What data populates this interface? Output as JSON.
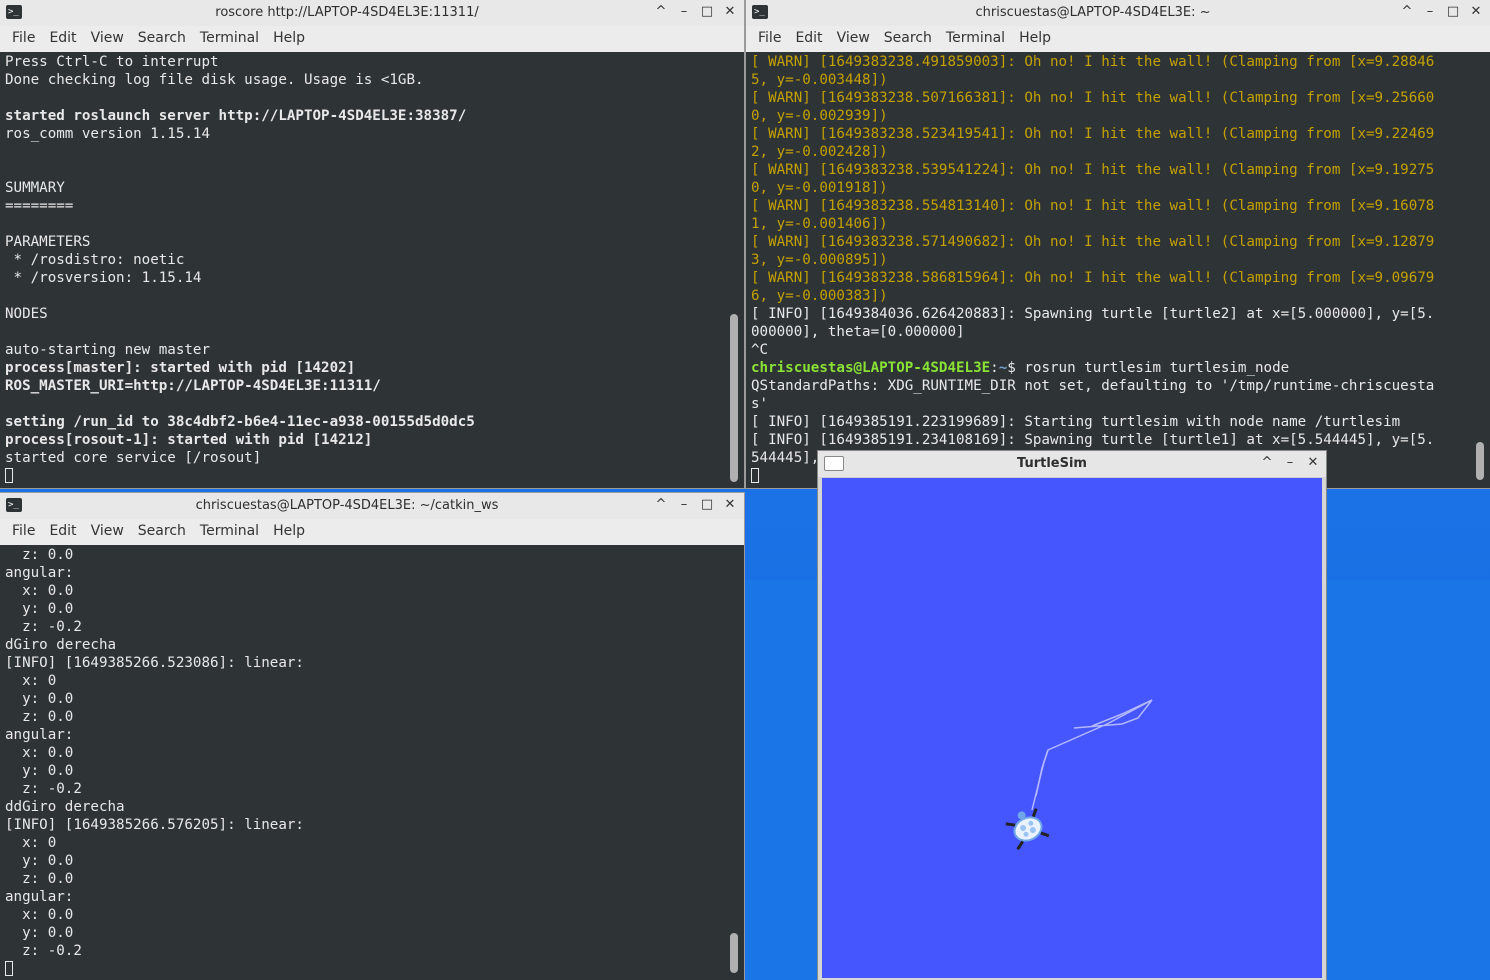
{
  "colors": {
    "terminal_bg": "#2e3436",
    "warn_text": "#c4a000",
    "prompt_user": "#8ae234",
    "prompt_path": "#729fcf",
    "turtlesim_bg": "#4556ff",
    "desktop": "#1a73e8"
  },
  "menus": [
    "File",
    "Edit",
    "View",
    "Search",
    "Terminal",
    "Help"
  ],
  "window_buttons": {
    "maximize": "^",
    "minimize": "–",
    "restore": "□",
    "close": "✕"
  },
  "roscore": {
    "title": "roscore http://LAPTOP-4SD4EL3E:11311/",
    "lines": [
      {
        "t": "Press Ctrl-C to interrupt",
        "s": ""
      },
      {
        "t": "Done checking log file disk usage. Usage is <1GB.",
        "s": ""
      },
      {
        "t": "",
        "s": ""
      },
      {
        "t": "started roslaunch server http://LAPTOP-4SD4EL3E:38387/",
        "s": "bold"
      },
      {
        "t": "ros_comm version 1.15.14",
        "s": ""
      },
      {
        "t": "",
        "s": ""
      },
      {
        "t": "",
        "s": ""
      },
      {
        "t": "SUMMARY",
        "s": ""
      },
      {
        "t": "========",
        "s": ""
      },
      {
        "t": "",
        "s": ""
      },
      {
        "t": "PARAMETERS",
        "s": ""
      },
      {
        "t": " * /rosdistro: noetic",
        "s": ""
      },
      {
        "t": " * /rosversion: 1.15.14",
        "s": ""
      },
      {
        "t": "",
        "s": ""
      },
      {
        "t": "NODES",
        "s": ""
      },
      {
        "t": "",
        "s": ""
      },
      {
        "t": "auto-starting new master",
        "s": ""
      },
      {
        "t": "process[master]: started with pid [14202]",
        "s": "bold"
      },
      {
        "t": "ROS_MASTER_URI=http://LAPTOP-4SD4EL3E:11311/",
        "s": "bold"
      },
      {
        "t": "",
        "s": ""
      },
      {
        "t": "setting /run_id to 38c4dbf2-b6e4-11ec-a938-00155d5d0dc5",
        "s": "bold"
      },
      {
        "t": "process[rosout-1]: started with pid [14212]",
        "s": "bold"
      },
      {
        "t": "started core service [/rosout]",
        "s": ""
      }
    ]
  },
  "turtlenode": {
    "title": "chriscuestas@LAPTOP-4SD4EL3E: ~",
    "lines_before": [
      {
        "t": "[ WARN] [1649383238.491859003]: Oh no! I hit the wall! (Clamping from [x=9.28846",
        "s": "warn"
      },
      {
        "t": "5, y=-0.003448])",
        "s": "warn"
      },
      {
        "t": "[ WARN] [1649383238.507166381]: Oh no! I hit the wall! (Clamping from [x=9.25660",
        "s": "warn"
      },
      {
        "t": "0, y=-0.002939])",
        "s": "warn"
      },
      {
        "t": "[ WARN] [1649383238.523419541]: Oh no! I hit the wall! (Clamping from [x=9.22469",
        "s": "warn"
      },
      {
        "t": "2, y=-0.002428])",
        "s": "warn"
      },
      {
        "t": "[ WARN] [1649383238.539541224]: Oh no! I hit the wall! (Clamping from [x=9.19275",
        "s": "warn"
      },
      {
        "t": "0, y=-0.001918])",
        "s": "warn"
      },
      {
        "t": "[ WARN] [1649383238.554813140]: Oh no! I hit the wall! (Clamping from [x=9.16078",
        "s": "warn"
      },
      {
        "t": "1, y=-0.001406])",
        "s": "warn"
      },
      {
        "t": "[ WARN] [1649383238.571490682]: Oh no! I hit the wall! (Clamping from [x=9.12879",
        "s": "warn"
      },
      {
        "t": "3, y=-0.000895])",
        "s": "warn"
      },
      {
        "t": "[ WARN] [1649383238.586815964]: Oh no! I hit the wall! (Clamping from [x=9.09679",
        "s": "warn"
      },
      {
        "t": "6, y=-0.000383])",
        "s": "warn"
      },
      {
        "t": "[ INFO] [1649384036.626420883]: Spawning turtle [turtle2] at x=[5.000000], y=[5.",
        "s": ""
      },
      {
        "t": "000000], theta=[0.000000]",
        "s": ""
      },
      {
        "t": "^C",
        "s": ""
      }
    ],
    "prompt": {
      "user": "chriscuestas@LAPTOP-4SD4EL3E",
      "sep": ":",
      "path": "~",
      "end": "$ ",
      "command": "rosrun turtlesim turtlesim_node"
    },
    "lines_after": [
      {
        "t": "QStandardPaths: XDG_RUNTIME_DIR not set, defaulting to '/tmp/runtime-chriscuesta",
        "s": ""
      },
      {
        "t": "s'",
        "s": ""
      },
      {
        "t": "[ INFO] [1649385191.223199689]: Starting turtlesim with node name /turtlesim",
        "s": ""
      },
      {
        "t": "[ INFO] [1649385191.234108169]: Spawning turtle [turtle1] at x=[5.544445], y=[5.",
        "s": ""
      },
      {
        "t": "544445],",
        "s": ""
      }
    ]
  },
  "catkin": {
    "title": "chriscuestas@LAPTOP-4SD4EL3E: ~/catkin_ws",
    "lines": [
      {
        "t": "  z: 0.0",
        "s": ""
      },
      {
        "t": "angular:",
        "s": ""
      },
      {
        "t": "  x: 0.0",
        "s": ""
      },
      {
        "t": "  y: 0.0",
        "s": ""
      },
      {
        "t": "  z: -0.2",
        "s": ""
      },
      {
        "t": "dGiro derecha",
        "s": ""
      },
      {
        "t": "[INFO] [1649385266.523086]: linear:",
        "s": ""
      },
      {
        "t": "  x: 0",
        "s": ""
      },
      {
        "t": "  y: 0.0",
        "s": ""
      },
      {
        "t": "  z: 0.0",
        "s": ""
      },
      {
        "t": "angular:",
        "s": ""
      },
      {
        "t": "  x: 0.0",
        "s": ""
      },
      {
        "t": "  y: 0.0",
        "s": ""
      },
      {
        "t": "  z: -0.2",
        "s": ""
      },
      {
        "t": "ddGiro derecha",
        "s": ""
      },
      {
        "t": "[INFO] [1649385266.576205]: linear:",
        "s": ""
      },
      {
        "t": "  x: 0",
        "s": ""
      },
      {
        "t": "  y: 0.0",
        "s": ""
      },
      {
        "t": "  z: 0.0",
        "s": ""
      },
      {
        "t": "angular:",
        "s": ""
      },
      {
        "t": "  x: 0.0",
        "s": ""
      },
      {
        "t": "  y: 0.0",
        "s": ""
      },
      {
        "t": "  z: -0.2",
        "s": ""
      }
    ]
  },
  "turtlesim": {
    "title": "TurtleSim",
    "icons": {
      "trail": "turtle-trail",
      "turtle": "turtle-icon"
    }
  }
}
